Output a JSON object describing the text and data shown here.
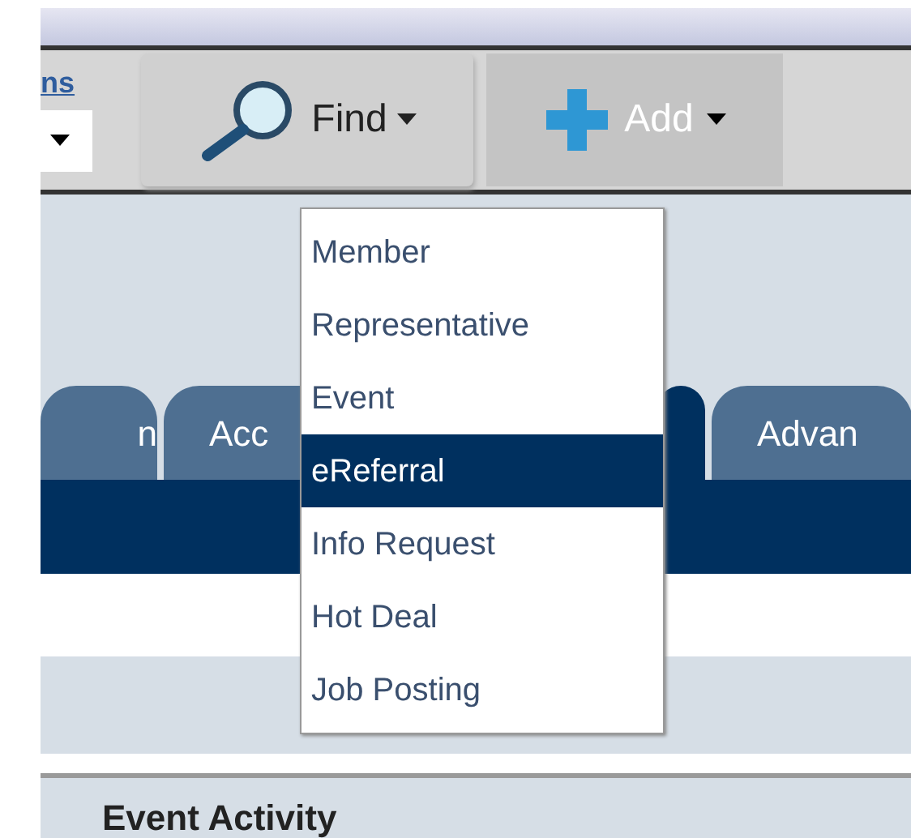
{
  "toolbar": {
    "link": "ns",
    "find_button": {
      "label": "Find"
    },
    "add_button": {
      "label": "Add",
      "expanded": true
    }
  },
  "tabs": [
    {
      "label": "n",
      "selected": false
    },
    {
      "label": "Acc",
      "selected": false
    },
    {
      "selected": true
    },
    {
      "label": "Advan",
      "selected": false
    }
  ],
  "add_menu": [
    {
      "label": "Member",
      "selected": false
    },
    {
      "label": "Representative",
      "selected": false
    },
    {
      "label": "Event",
      "selected": false
    },
    {
      "label": "eReferral",
      "selected": true
    },
    {
      "label": "Info Request",
      "selected": false
    },
    {
      "label": "Hot Deal",
      "selected": false
    },
    {
      "label": "Job Posting",
      "selected": false
    }
  ],
  "section_header": "Event Activity"
}
